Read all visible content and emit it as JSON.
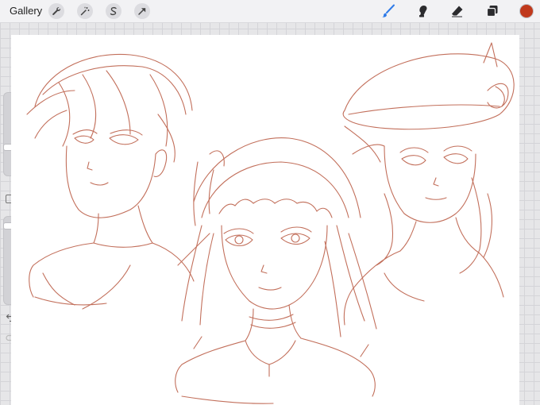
{
  "app": {
    "gallery_label": "Gallery"
  },
  "toolbar_left": [
    {
      "name": "actions-wrench-icon"
    },
    {
      "name": "adjustments-wand-icon"
    },
    {
      "name": "selection-s-icon"
    },
    {
      "name": "transform-arrow-icon"
    }
  ],
  "toolbar_right": [
    {
      "name": "brush-icon",
      "active": true
    },
    {
      "name": "smudge-icon",
      "active": false
    },
    {
      "name": "eraser-icon",
      "active": false
    },
    {
      "name": "layers-icon",
      "active": false
    }
  ],
  "colors": {
    "brand_blue": "#2f7be8",
    "current_color": "#c0391c",
    "stroke": "#b8573f",
    "toolbar_bg": "#f2f2f4"
  },
  "sidebar": {
    "brush_size_level": 0.78,
    "opacity_level": 0.1,
    "undo_icon": "undo-icon",
    "redo_icon": "redo-icon"
  }
}
